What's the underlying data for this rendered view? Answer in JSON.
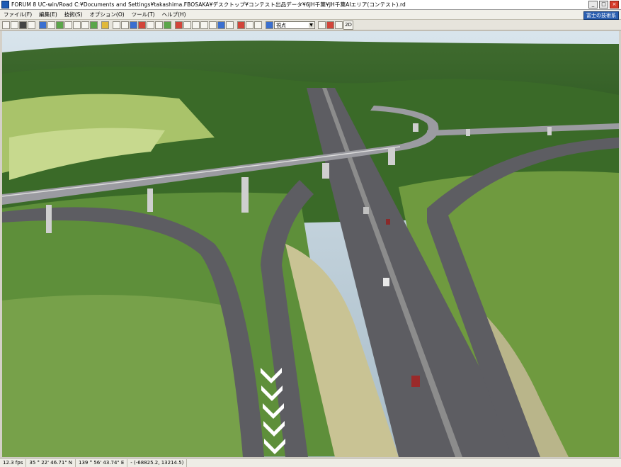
{
  "window": {
    "title": "FORUM 8   UC-win/Road   C:¥Documents and Settings¥takashima.FBOSAKA¥デスクトップ¥コンテスト出品データ¥6JH千葉¥JH千葉AIエリア(コンテスト).rd",
    "help_badge": "富士の技術系"
  },
  "menu": [
    "ファイル(F)",
    "編集(E)",
    "技術(S)",
    "オプション(O)",
    "ツール(T)",
    "ヘルプ(H)"
  ],
  "toolbar": {
    "view_select": "視点",
    "mode_2d": "2D"
  },
  "status": {
    "fps": "12.3 fps",
    "latitude": "35 °  22' 46.71\" N",
    "longitude": "139 °  56' 43.74\" E",
    "coords": "-  (-68825.2, 13214.5)"
  },
  "scene": {
    "description_icon": "3d-road-scene"
  }
}
